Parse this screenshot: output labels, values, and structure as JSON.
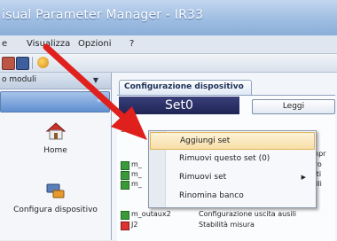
{
  "window": {
    "title": "isual Parameter Manager - IR33"
  },
  "menu": {
    "items": [
      "e",
      "Visualizza",
      "Opzioni",
      "?"
    ]
  },
  "left_pane": {
    "header": "o moduli",
    "nav": [
      {
        "label": "Home",
        "icon": "home-icon"
      },
      {
        "label": "Configura dispositivo",
        "icon": "configure-device-icon"
      }
    ]
  },
  "main": {
    "tab_label": "Configurazione dispositivo",
    "set_name": "Set0",
    "read_button": "Leggi",
    "set_label": "Set",
    "rows": [
      {
        "c1": "m_",
        "c2": "",
        "c2_tail": "ne"
      },
      {
        "c1": "m_",
        "c2": "",
        "c2_tail": "compr"
      },
      {
        "c1": "m_",
        "c2": "",
        "c2_tail": "defro"
      },
      {
        "c1": "m_",
        "c2": "",
        "c2_tail": "venti"
      },
      {
        "c1": "m_",
        "c2": "",
        "c2_tail": "ausili"
      },
      {
        "c1": "m_outaux2",
        "c2": "Configurazione uscita ausili",
        "c2_tail": ""
      },
      {
        "c1": "J2",
        "c2": "Stabilità misura",
        "c2_tail": ""
      }
    ]
  },
  "context_menu": {
    "items": [
      {
        "label": "Aggiungi set",
        "highlighted": true,
        "submenu": false
      },
      {
        "label": "Rimuovi questo set (0)",
        "highlighted": false,
        "submenu": false
      },
      {
        "label": "Rimuovi set",
        "highlighted": false,
        "submenu": true
      },
      {
        "label": "Rinomina banco",
        "highlighted": false,
        "submenu": false
      }
    ]
  },
  "colors": {
    "annotation_arrow": "#e0201c",
    "set_bar": "#2a3066"
  }
}
